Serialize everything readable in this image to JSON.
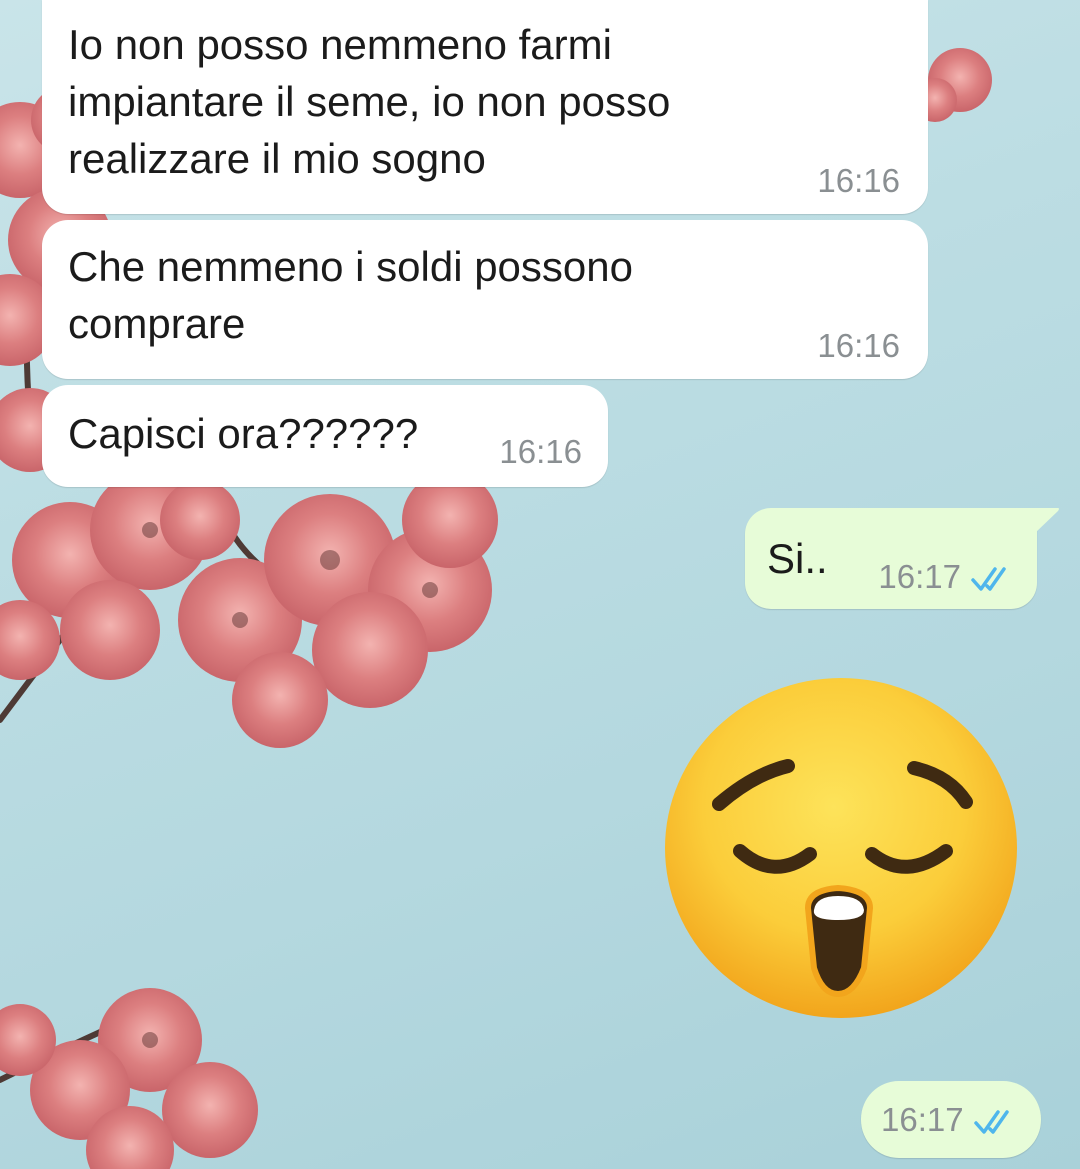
{
  "conversation": {
    "messages": [
      {
        "direction": "incoming",
        "text": "Io non posso nemmeno farmi\nimpiantare il seme, io non posso\nrealizzare il mio sogno",
        "time": "16:16"
      },
      {
        "direction": "incoming",
        "text": "Che nemmeno i soldi possono\ncomprare",
        "time": "16:16"
      },
      {
        "direction": "incoming",
        "text": "Capisci ora??????",
        "time": "16:16"
      },
      {
        "direction": "outgoing",
        "text": "Si..",
        "time": "16:17",
        "status": "read"
      },
      {
        "direction": "outgoing",
        "type": "sticker-emoji",
        "emoji": "sleepy-face-emoji",
        "time": "16:17",
        "status": "read"
      }
    ]
  },
  "colors": {
    "incoming_bubble": "#ffffff",
    "outgoing_bubble": "#e7fcd8",
    "read_ticks": "#4fb6ec",
    "timestamp": "#8a8f92",
    "wallpaper_sky": "#bcdde3",
    "blossom": "#d9777a"
  }
}
